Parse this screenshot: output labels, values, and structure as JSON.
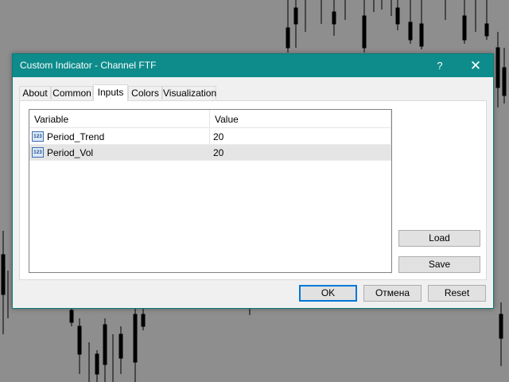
{
  "dialog": {
    "title": "Custom Indicator - Channel FTF",
    "help_glyph": "?",
    "close_glyph": "✕"
  },
  "tabs": [
    {
      "label": "About"
    },
    {
      "label": "Common"
    },
    {
      "label": "Inputs",
      "active": true
    },
    {
      "label": "Colors"
    },
    {
      "label": "Visualization"
    }
  ],
  "grid": {
    "columns": {
      "variable": "Variable",
      "value": "Value"
    },
    "rows": [
      {
        "icon": "123",
        "name": "Period_Trend",
        "value": "20"
      },
      {
        "icon": "123",
        "name": "Period_Vol",
        "value": "20",
        "selected": true
      }
    ]
  },
  "side_buttons": {
    "load": "Load",
    "save": "Save"
  },
  "bottom_buttons": {
    "ok": "OK",
    "cancel": "Отмена",
    "reset": "Reset"
  },
  "colors": {
    "titlebar": "#0e8b8b",
    "backdrop": "#8e8e8e",
    "candles": "#000000"
  }
}
